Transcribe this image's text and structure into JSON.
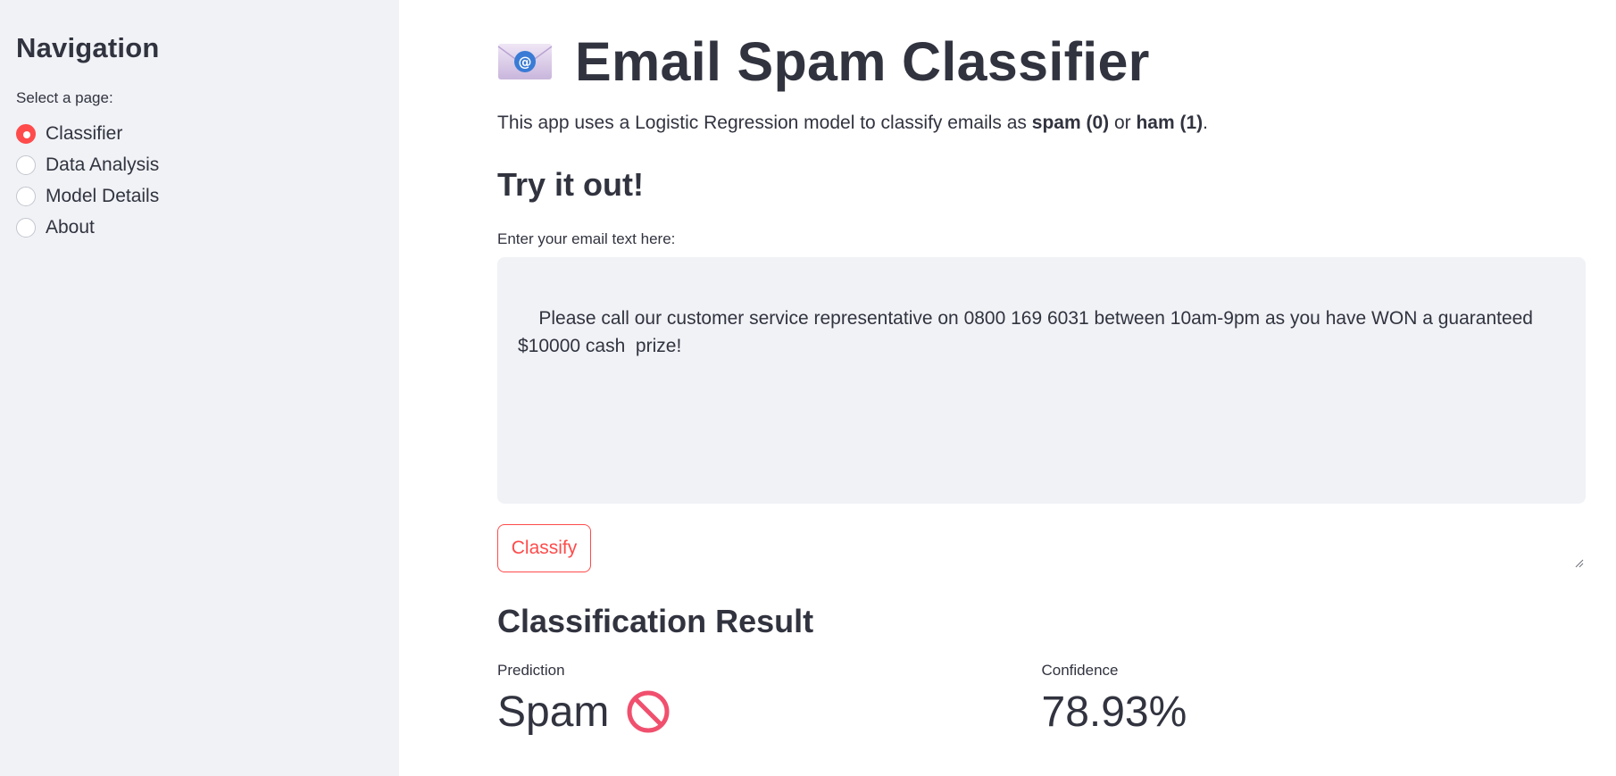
{
  "sidebar": {
    "title": "Navigation",
    "radio_caption": "Select a page:",
    "items": [
      {
        "label": "Classifier",
        "selected": true
      },
      {
        "label": "Data Analysis",
        "selected": false
      },
      {
        "label": "Model Details",
        "selected": false
      },
      {
        "label": "About",
        "selected": false
      }
    ]
  },
  "header": {
    "icon": "envelope-at-icon",
    "title": "Email Spam Classifier"
  },
  "description": {
    "prefix": "This app uses a Logistic Regression model to classify emails as ",
    "spam": "spam (0)",
    "middle": " or ",
    "ham": "ham (1)",
    "suffix": "."
  },
  "try_it": {
    "heading": "Try it out!",
    "input_label": "Enter your email text here:",
    "input_value": "Please call our customer service representative on 0800 169 6031 between 10am-9pm as you have WON a guaranteed $10000 cash  prize!",
    "button_label": "Classify"
  },
  "result": {
    "heading": "Classification Result",
    "prediction_label": "Prediction",
    "prediction_value": "Spam",
    "prediction_icon": "no-entry-icon",
    "confidence_label": "Confidence",
    "confidence_value": "78.93%"
  },
  "colors": {
    "accent": "#ff4b4b",
    "sidebar_bg": "#f0f2f6",
    "text": "#31333f"
  }
}
